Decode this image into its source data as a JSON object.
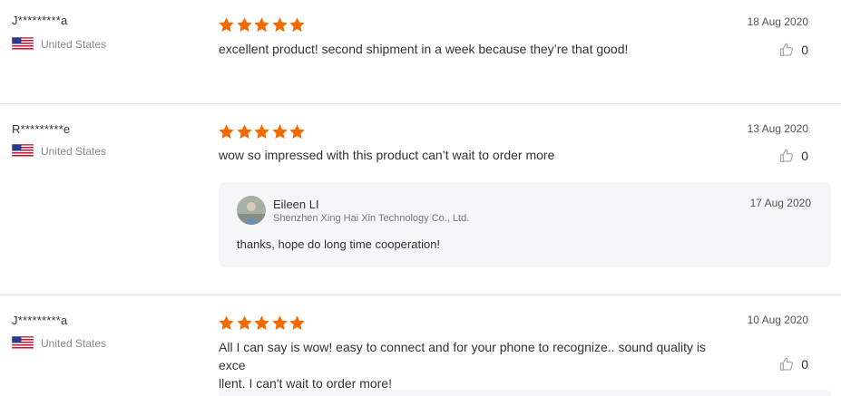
{
  "reviews": [
    {
      "reviewer": "J*********a",
      "country": "United States",
      "rating": 5,
      "date": "18 Aug 2020",
      "text": "excellent product!  second shipment in a week because they’re that good!",
      "helpful_count": "0"
    },
    {
      "reviewer": "R*********e",
      "country": "United States",
      "rating": 5,
      "date": "13 Aug 2020",
      "text": "wow so impressed with this product can’t wait to order more",
      "helpful_count": "0",
      "reply": {
        "name": "Eileen LI",
        "company": "Shenzhen Xing Hai Xin Technology Co., Ltd.",
        "date": "17 Aug 2020",
        "text": "thanks, hope do long time cooperation!"
      }
    },
    {
      "reviewer": "J*********a",
      "country": "United States",
      "rating": 5,
      "date": "10 Aug 2020",
      "text_line1": "All I can say is wow! easy to connect and for your phone to recognize.. sound quality is exce",
      "text_line2": "llent. I can't wait to order more!",
      "helpful_count": "0"
    }
  ],
  "colors": {
    "star": "#f56a00",
    "divider": "#e8e8e8",
    "reply_bg": "#f5f6f8"
  },
  "icons": {
    "flag": "us-flag-icon",
    "star": "star-icon",
    "helpful": "thumbs-up-icon",
    "avatar": "avatar"
  }
}
